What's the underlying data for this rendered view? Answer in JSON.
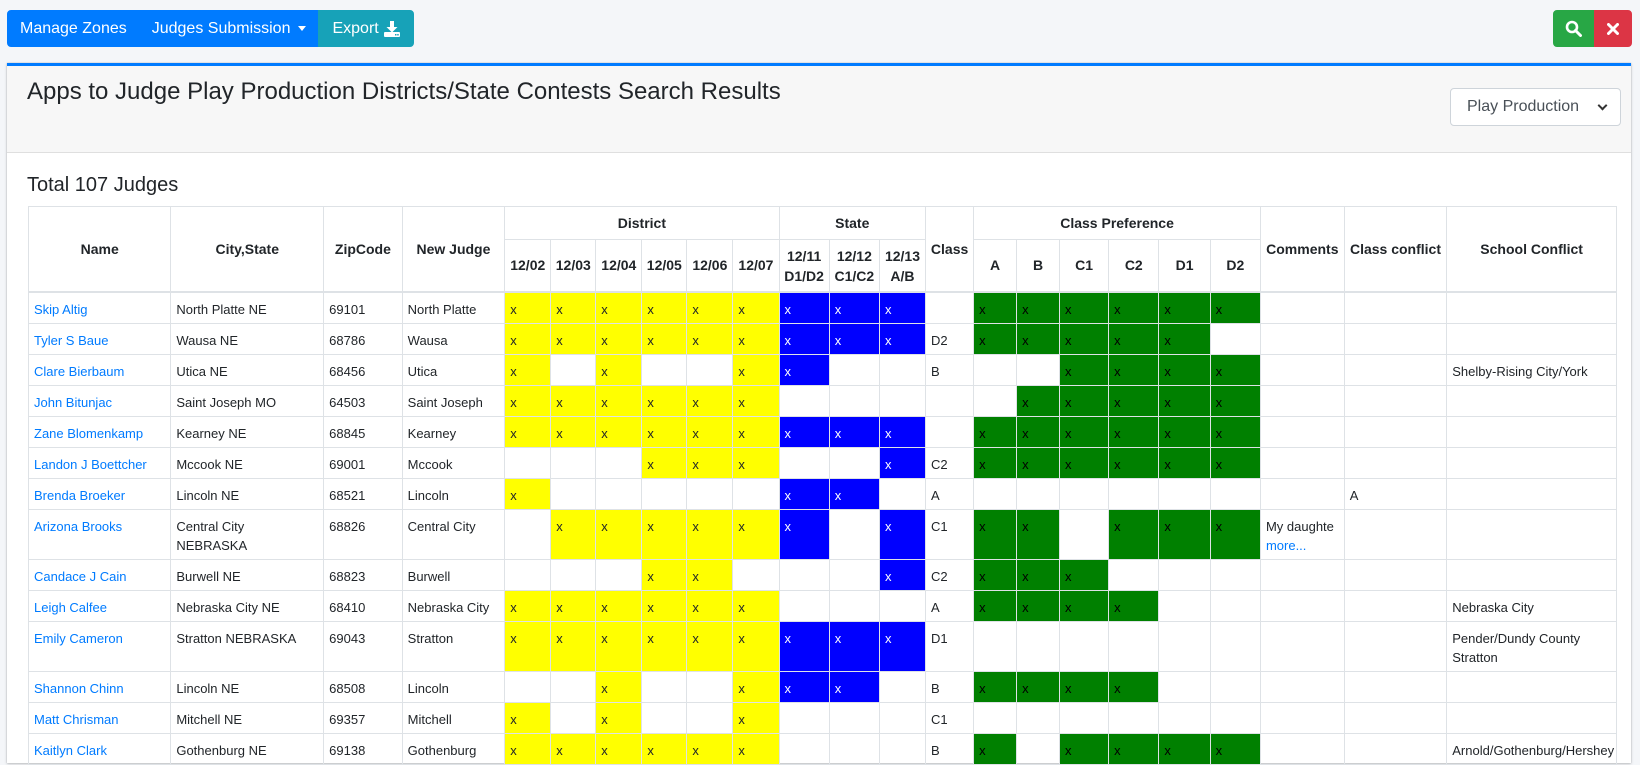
{
  "toolbar": {
    "manage_zones": "Manage Zones",
    "judges_submission": "Judges Submission",
    "export": "Export"
  },
  "header": {
    "title": "Apps to Judge Play Production Districts/State Contests Search Results",
    "contest_select": "Play Production"
  },
  "total_label": "Total 107 Judges",
  "table": {
    "group_headers": {
      "district": "District",
      "state": "State",
      "class_pref": "Class Preference"
    },
    "headers": {
      "name": "Name",
      "city_state": "City,State",
      "zip": "ZipCode",
      "new_judge": "New Judge",
      "class": "Class",
      "comments": "Comments",
      "class_conflict": "Class conflict",
      "school_conflict": "School Conflict"
    },
    "district_cols": [
      "12/02",
      "12/03",
      "12/04",
      "12/05",
      "12/06",
      "12/07"
    ],
    "state_cols": [
      {
        "date": "12/11",
        "classes": "D1/D2"
      },
      {
        "date": "12/12",
        "classes": "C1/C2"
      },
      {
        "date": "12/13",
        "classes": "A/B"
      }
    ],
    "pref_cols": [
      "A",
      "B",
      "C1",
      "C2",
      "D1",
      "D2"
    ],
    "mark": "x",
    "rows": [
      {
        "name": "Skip Altig",
        "city": "North Platte NE",
        "zip": "69101",
        "new_judge": "North Platte",
        "district": [
          1,
          1,
          1,
          1,
          1,
          1
        ],
        "state": [
          1,
          1,
          1
        ],
        "class": "",
        "pref": [
          1,
          1,
          1,
          1,
          1,
          1
        ],
        "comment": "",
        "comment_more": "",
        "class_conflict": "",
        "school_conflict": ""
      },
      {
        "name": "Tyler S Baue",
        "city": "Wausa NE",
        "zip": "68786",
        "new_judge": "Wausa",
        "district": [
          1,
          1,
          1,
          1,
          1,
          1
        ],
        "state": [
          1,
          1,
          1
        ],
        "class": "D2",
        "pref": [
          1,
          1,
          1,
          1,
          1,
          0
        ],
        "comment": "",
        "comment_more": "",
        "class_conflict": "",
        "school_conflict": ""
      },
      {
        "name": "Clare Bierbaum",
        "city": "Utica NE",
        "zip": "68456",
        "new_judge": "Utica",
        "district": [
          1,
          0,
          1,
          0,
          0,
          1
        ],
        "state": [
          1,
          0,
          0
        ],
        "class": "B",
        "pref": [
          0,
          0,
          1,
          1,
          1,
          1
        ],
        "comment": "",
        "comment_more": "",
        "class_conflict": "",
        "school_conflict": "Shelby-Rising City/York"
      },
      {
        "name": "John Bitunjac",
        "city": "Saint Joseph MO",
        "zip": "64503",
        "new_judge": "Saint Joseph",
        "district": [
          1,
          1,
          1,
          1,
          1,
          1
        ],
        "state": [
          0,
          0,
          0
        ],
        "class": "",
        "pref": [
          0,
          1,
          1,
          1,
          1,
          1
        ],
        "comment": "",
        "comment_more": "",
        "class_conflict": "",
        "school_conflict": ""
      },
      {
        "name": "Zane Blomenkamp",
        "city": "Kearney NE",
        "zip": "68845",
        "new_judge": "Kearney",
        "district": [
          1,
          1,
          1,
          1,
          1,
          1
        ],
        "state": [
          1,
          1,
          1
        ],
        "class": "",
        "pref": [
          1,
          1,
          1,
          1,
          1,
          1
        ],
        "comment": "",
        "comment_more": "",
        "class_conflict": "",
        "school_conflict": ""
      },
      {
        "name": "Landon J Boettcher",
        "city": "Mccook NE",
        "zip": "69001",
        "new_judge": "Mccook",
        "district": [
          0,
          0,
          0,
          1,
          1,
          1
        ],
        "state": [
          0,
          0,
          1
        ],
        "class": "C2",
        "pref": [
          1,
          1,
          1,
          1,
          1,
          1
        ],
        "comment": "",
        "comment_more": "",
        "class_conflict": "",
        "school_conflict": ""
      },
      {
        "name": "Brenda Broeker",
        "city": "Lincoln NE",
        "zip": "68521",
        "new_judge": "Lincoln",
        "district": [
          1,
          0,
          0,
          0,
          0,
          0
        ],
        "state": [
          1,
          1,
          0
        ],
        "class": "A",
        "pref": [
          0,
          0,
          0,
          0,
          0,
          0
        ],
        "comment": "",
        "comment_more": "",
        "class_conflict": "A",
        "school_conflict": ""
      },
      {
        "name": "Arizona Brooks",
        "city": "Central City NEBRASKA",
        "zip": "68826",
        "new_judge": "Central City",
        "district": [
          0,
          1,
          1,
          1,
          1,
          1
        ],
        "state": [
          1,
          0,
          1
        ],
        "class": "C1",
        "pref": [
          1,
          1,
          0,
          1,
          1,
          1
        ],
        "comment": "My daughte",
        "comment_more": "more...",
        "class_conflict": "",
        "school_conflict": ""
      },
      {
        "name": "Candace J Cain",
        "city": "Burwell NE",
        "zip": "68823",
        "new_judge": "Burwell",
        "district": [
          0,
          0,
          0,
          1,
          1,
          0
        ],
        "state": [
          0,
          0,
          1
        ],
        "class": "C2",
        "pref": [
          1,
          1,
          1,
          0,
          0,
          0
        ],
        "comment": "",
        "comment_more": "",
        "class_conflict": "",
        "school_conflict": ""
      },
      {
        "name": "Leigh Calfee",
        "city": "Nebraska City NE",
        "zip": "68410",
        "new_judge": "Nebraska City",
        "district": [
          1,
          1,
          1,
          1,
          1,
          1
        ],
        "state": [
          0,
          0,
          0
        ],
        "class": "A",
        "pref": [
          1,
          1,
          1,
          1,
          0,
          0
        ],
        "comment": "",
        "comment_more": "",
        "class_conflict": "",
        "school_conflict": "Nebraska City"
      },
      {
        "name": "Emily Cameron",
        "city": "Stratton NEBRASKA",
        "zip": "69043",
        "new_judge": "Stratton",
        "district": [
          1,
          1,
          1,
          1,
          1,
          1
        ],
        "state": [
          1,
          1,
          1
        ],
        "class": "D1",
        "pref": [
          0,
          0,
          0,
          0,
          0,
          0
        ],
        "comment": "",
        "comment_more": "",
        "class_conflict": "",
        "school_conflict": "Pender/Dundy County Stratton"
      },
      {
        "name": "Shannon Chinn",
        "city": "Lincoln NE",
        "zip": "68508",
        "new_judge": "Lincoln",
        "district": [
          0,
          0,
          1,
          0,
          0,
          1
        ],
        "state": [
          1,
          1,
          0
        ],
        "class": "B",
        "pref": [
          1,
          1,
          1,
          1,
          0,
          0
        ],
        "comment": "",
        "comment_more": "",
        "class_conflict": "",
        "school_conflict": ""
      },
      {
        "name": "Matt Chrisman",
        "city": "Mitchell NE",
        "zip": "69357",
        "new_judge": "Mitchell",
        "district": [
          1,
          0,
          1,
          0,
          0,
          1
        ],
        "state": [
          0,
          0,
          0
        ],
        "class": "C1",
        "pref": [
          0,
          0,
          0,
          0,
          0,
          0
        ],
        "comment": "",
        "comment_more": "",
        "class_conflict": "",
        "school_conflict": ""
      },
      {
        "name": "Kaitlyn Clark",
        "city": "Gothenburg NE",
        "zip": "69138",
        "new_judge": "Gothenburg",
        "district": [
          1,
          1,
          1,
          1,
          1,
          1
        ],
        "state": [
          0,
          0,
          0
        ],
        "class": "B",
        "pref": [
          1,
          0,
          1,
          1,
          1,
          1
        ],
        "comment": "",
        "comment_more": "",
        "class_conflict": "",
        "school_conflict": "Arnold/Gothenburg/Hershey"
      }
    ]
  },
  "colors": {
    "primary": "#007bff",
    "info": "#17a2b8",
    "success": "#28a745",
    "danger": "#dc3545",
    "district_mark": "#ffff00",
    "state_mark": "#0000ff",
    "pref_mark": "#008000"
  },
  "icons": {
    "export": "download-icon",
    "search": "search-icon",
    "close": "close-icon",
    "dropdown": "caret-down-icon"
  }
}
